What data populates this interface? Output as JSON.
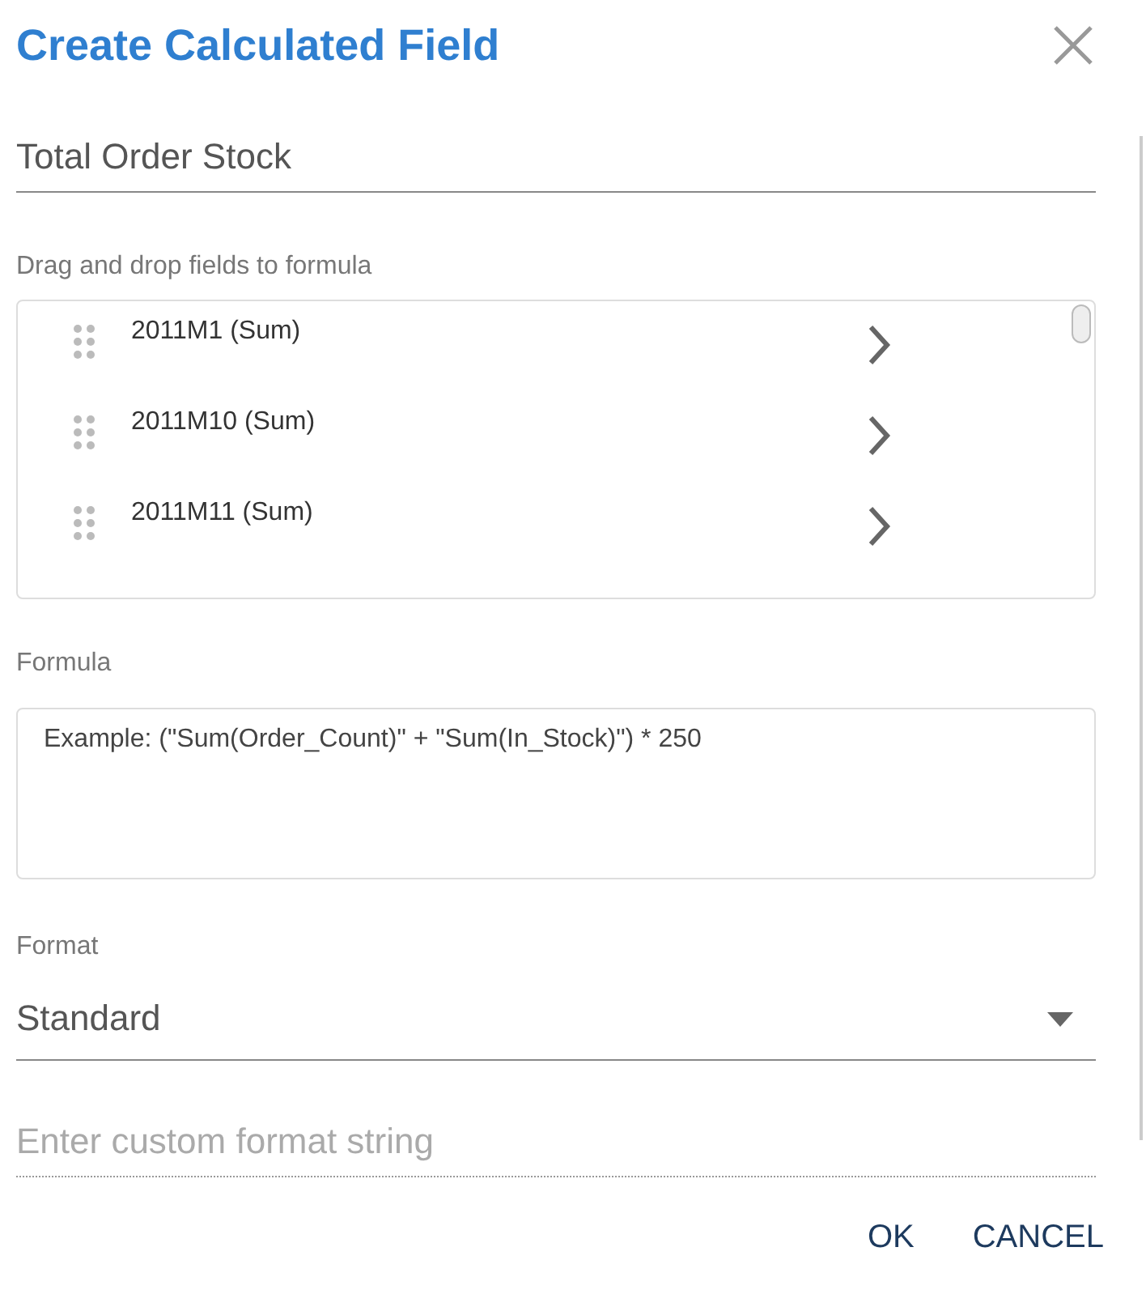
{
  "dialog": {
    "title": "Create Calculated Field"
  },
  "name_field": {
    "value": "Total Order Stock"
  },
  "fields_list": {
    "label": "Drag and drop fields to formula",
    "items": [
      {
        "label": "2011M1 (Sum)"
      },
      {
        "label": "2011M10 (Sum)"
      },
      {
        "label": "2011M11 (Sum)"
      }
    ]
  },
  "formula": {
    "label": "Formula",
    "placeholder": "Example: (\"Sum(Order_Count)\" + \"Sum(In_Stock)\") * 250"
  },
  "format": {
    "label": "Format",
    "value": "Standard"
  },
  "custom_format": {
    "placeholder": "Enter custom format string",
    "disabled": true
  },
  "buttons": [
    {
      "label": "OK"
    },
    {
      "label": "CANCEL"
    }
  ]
}
